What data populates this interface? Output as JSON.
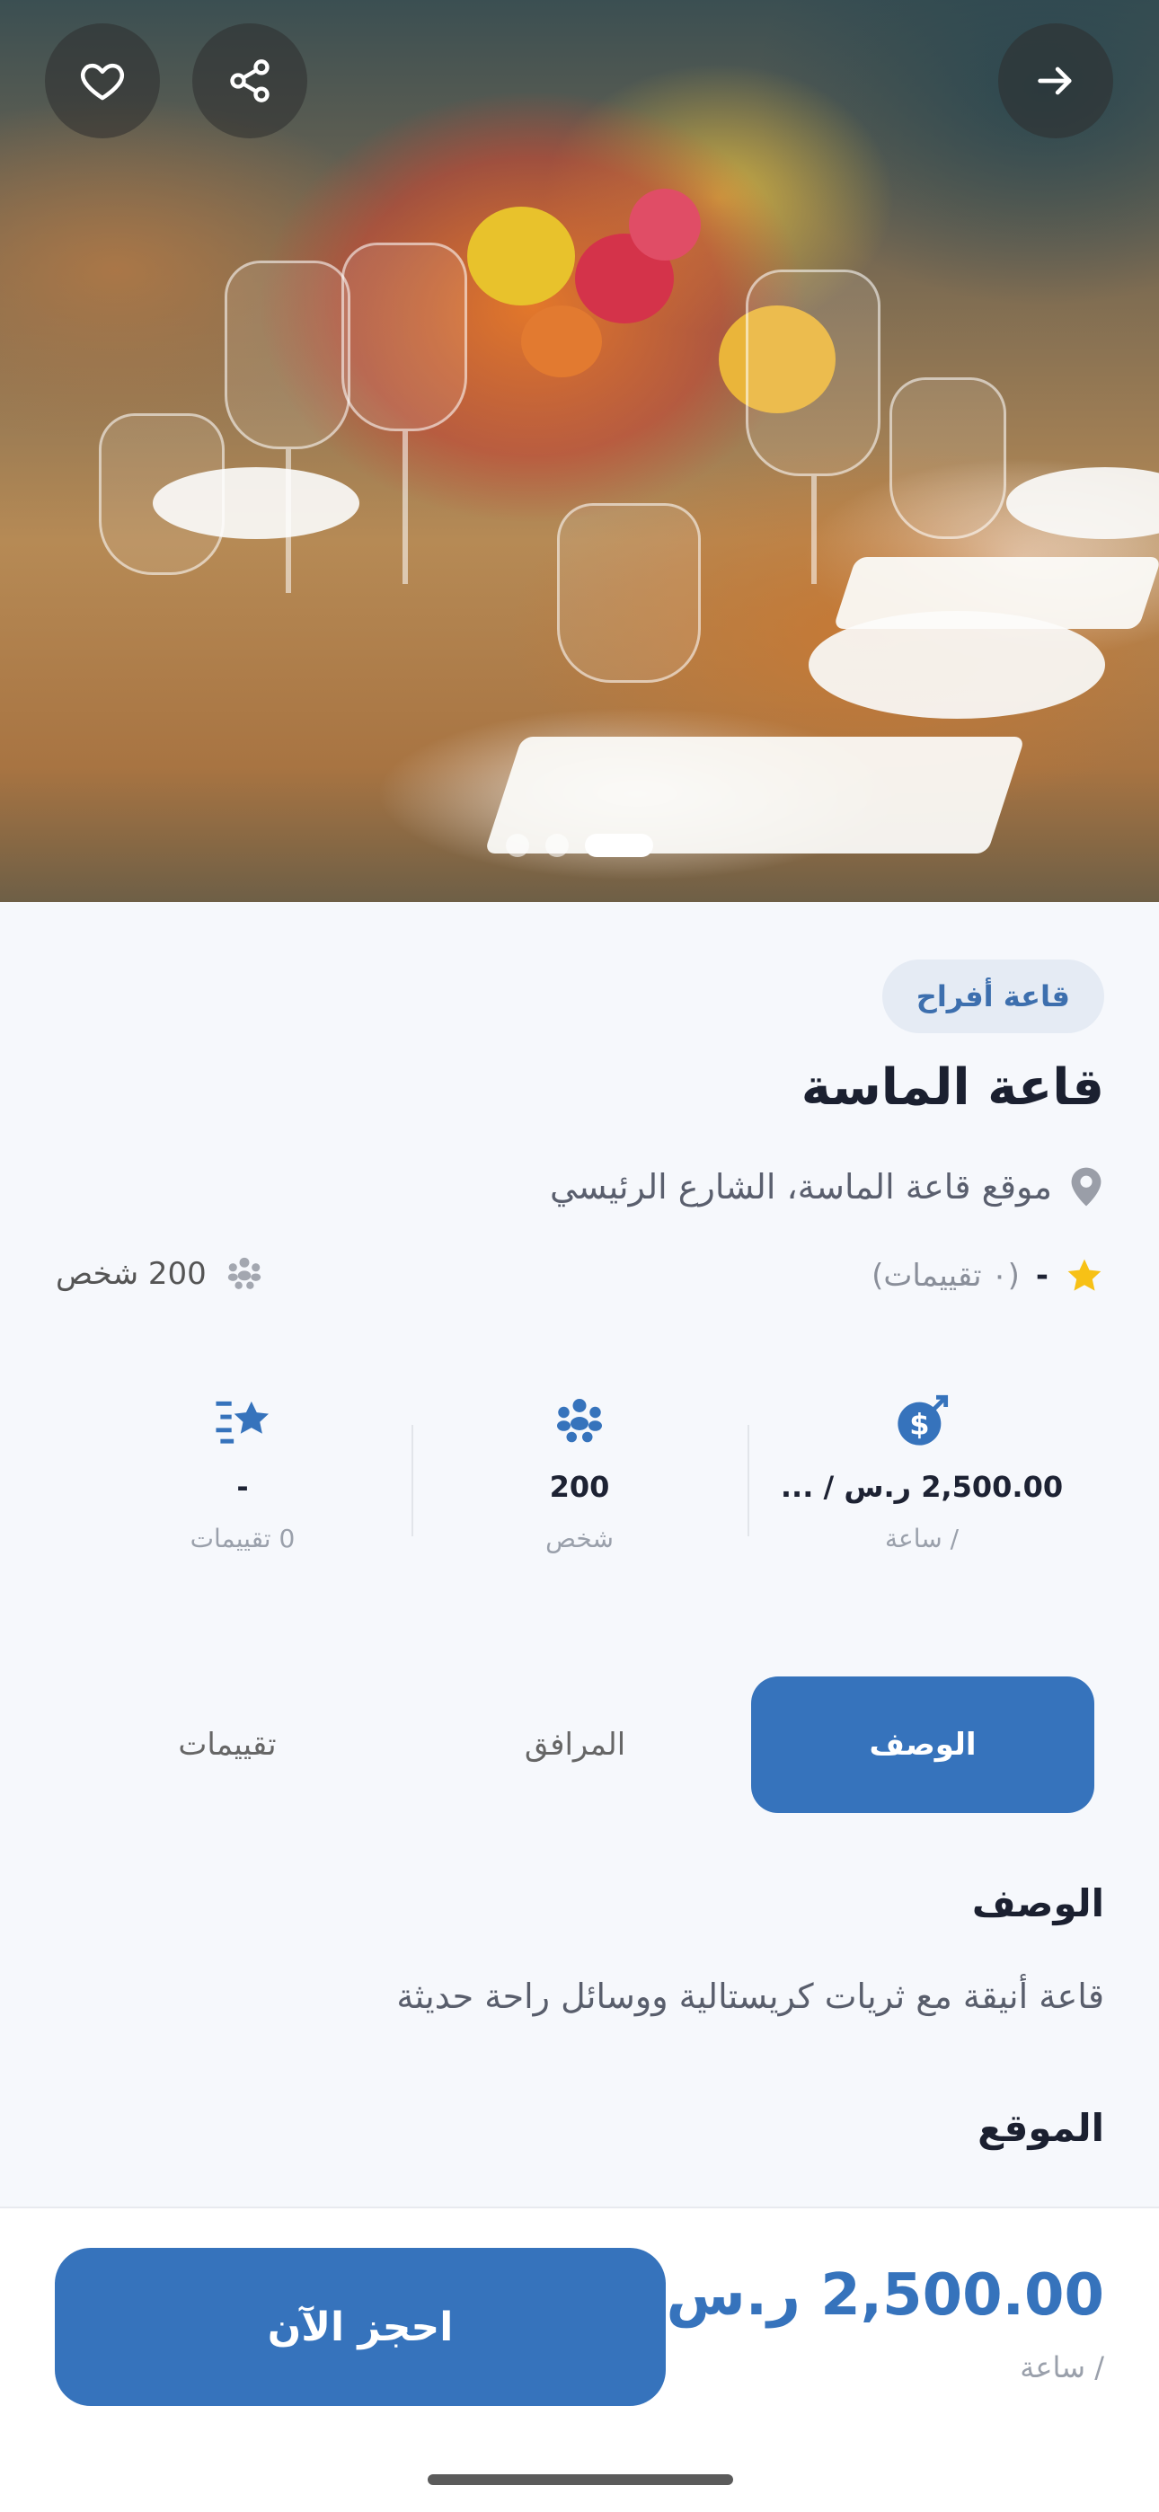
{
  "hero": {
    "slides_count": 3,
    "active_slide": 3,
    "buttons": {
      "back": "arrow-right-icon",
      "share": "share-icon",
      "favorite": "heart-icon"
    }
  },
  "venue": {
    "category": "قاعة أفراح",
    "name": "قاعة الماسة",
    "location": "موقع قاعة الماسة، الشارع الرئيسي",
    "rating_value": "-",
    "rating_count_text": "(٠ تقييمات)",
    "capacity_text": "200 شخص"
  },
  "stats": {
    "price": {
      "value": "2,500.00 ر.س / ...",
      "sub": "/ ساعة",
      "icon": "money-icon"
    },
    "capacity": {
      "value": "200",
      "sub": "شخص",
      "icon": "people-icon"
    },
    "reviews": {
      "value": "-",
      "sub": "0 تقييمات",
      "icon": "star-list-icon"
    }
  },
  "tabs": [
    {
      "label": "الوصف",
      "active": true
    },
    {
      "label": "المرافق",
      "active": false
    },
    {
      "label": "تقييمات",
      "active": false
    }
  ],
  "description": {
    "heading": "الوصف",
    "text": "قاعة أنيقة مع ثريات كريستالية ووسائل راحة حديثة"
  },
  "location_section": {
    "heading": "الموقع"
  },
  "booking": {
    "price": "2,500.00 ر.س",
    "per": "/ ساعة",
    "button_label": "احجز الآن"
  },
  "colors": {
    "primary": "#3673bc",
    "chip_bg": "#e5ebf4",
    "star": "#f7c116",
    "background": "#f6f8fc"
  }
}
